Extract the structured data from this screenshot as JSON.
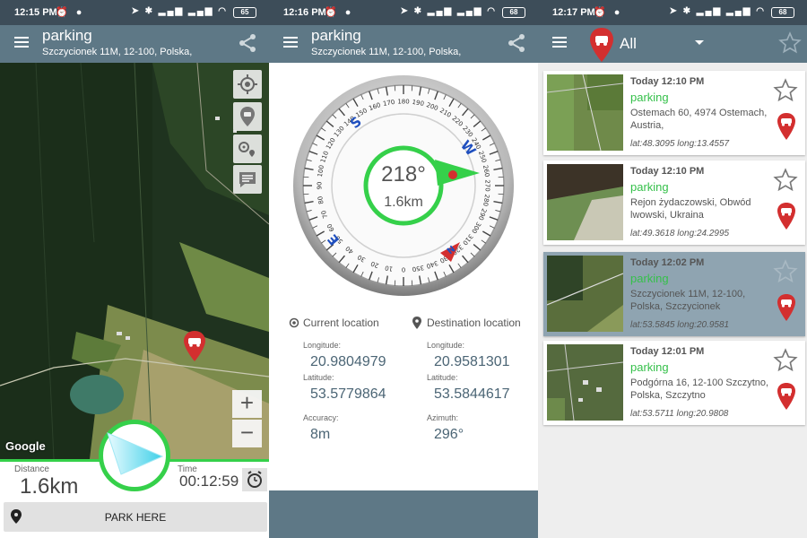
{
  "screens": [
    {
      "status": {
        "time": "12:15 PM",
        "battery": "65"
      },
      "appbar": {
        "title": "parking",
        "subtitle": "Szczycionek 11M, 12-100, Polska,"
      },
      "map": {
        "attribution": "Google",
        "zoom_in": "+",
        "zoom_out": "−"
      },
      "bottom": {
        "distance_label": "Distance",
        "distance_value": "1.6km",
        "time_label": "Time",
        "time_value": "00:12:59",
        "park_button": "PARK HERE"
      }
    },
    {
      "status": {
        "time": "12:16 PM",
        "battery": "68"
      },
      "appbar": {
        "title": "parking",
        "subtitle": "Szczycionek 11M, 12-100, Polska,"
      },
      "compass": {
        "heading": "218°",
        "distance": "1.6km",
        "letters": {
          "s": "S",
          "w": "W",
          "e": "E",
          "n": "N"
        },
        "ticks": [
          "180",
          "190",
          "200",
          "210",
          "220",
          "230",
          "240",
          "250",
          "260",
          "270",
          "280",
          "290",
          "300",
          "310",
          "320",
          "330",
          "340",
          "350",
          "0",
          "10",
          "20",
          "30",
          "40",
          "50",
          "60",
          "70",
          "80",
          "90",
          "100",
          "110",
          "120",
          "130",
          "140",
          "150",
          "160",
          "170"
        ]
      },
      "current": {
        "title": "Current location",
        "longitude_label": "Longitude:",
        "longitude": "20.9804979",
        "latitude_label": "Latitude:",
        "latitude": "53.5779864",
        "accuracy_label": "Accuracy:",
        "accuracy": "8m"
      },
      "destination": {
        "title": "Destination location",
        "longitude_label": "Longitude:",
        "longitude": "20.9581301",
        "latitude_label": "Latitude:",
        "latitude": "53.5844617",
        "azimuth_label": "Azimuth:",
        "azimuth": "296°"
      }
    },
    {
      "status": {
        "time": "12:17 PM",
        "battery": "68"
      },
      "appbar": {
        "filter": "All"
      },
      "items": [
        {
          "time": "Today  12:10 PM",
          "name": "parking",
          "address": "Ostemach 60, 4974 Ostemach, Austria,",
          "coords": "lat:48.3095   long:13.4557"
        },
        {
          "time": "Today  12:10 PM",
          "name": "parking",
          "address": "Rejon żydaczowski, Obwód lwowski, Ukraina",
          "coords": "lat:49.3618   long:24.2995"
        },
        {
          "time": "Today  12:02 PM",
          "name": "parking",
          "address": "Szczycionek 11M, 12-100, Polska, Szczycionek",
          "coords": "lat:53.5845   long:20.9581"
        },
        {
          "time": "Today  12:01 PM",
          "name": "parking",
          "address": "Podgórna 16, 12-100 Szczytno, Polska, Szczytno",
          "coords": "lat:53.5711   long:20.9808"
        }
      ]
    }
  ],
  "colors": {
    "statusbar": "#3d4d59",
    "appbar": "#5e7886",
    "accent_green": "#35d04a",
    "marker_red": "#d32f2f"
  }
}
